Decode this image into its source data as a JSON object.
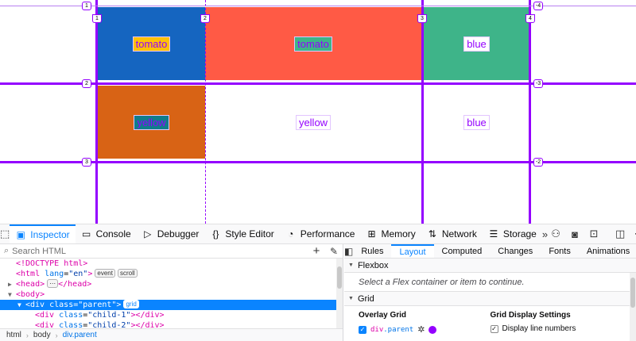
{
  "viewport": {
    "cells": [
      {
        "label": "tomato",
        "color": "#1565c0"
      },
      {
        "label": "tomato",
        "color": "#ffc107"
      },
      {
        "label": "blue",
        "color": "#ff5a45"
      },
      {
        "label": "yellow",
        "color": "#3eb489"
      },
      {
        "label": "yellow",
        "color": "#3eb489"
      },
      {
        "label": "blue",
        "color": "#ffffff"
      },
      {
        "label": "",
        "color": "#d86315"
      },
      {
        "label": "",
        "color": "#117c8c"
      },
      {
        "label": "",
        "color": "#ffffff"
      }
    ],
    "line_numbers": {
      "col_top": [
        "1",
        "2",
        "3",
        "4"
      ],
      "row_left": [
        "1",
        "2",
        "3"
      ],
      "row_right": [
        "-4",
        "-3",
        "-2"
      ],
      "col_corner": "1"
    },
    "overlay_color": "#9400ff"
  },
  "toolbar": {
    "tabs": [
      {
        "label": "Inspector",
        "icon": "inspector-icon"
      },
      {
        "label": "Console",
        "icon": "console-icon"
      },
      {
        "label": "Debugger",
        "icon": "debugger-icon"
      },
      {
        "label": "Style Editor",
        "icon": "style-editor-icon"
      },
      {
        "label": "Performance",
        "icon": "performance-icon"
      },
      {
        "label": "Memory",
        "icon": "memory-icon"
      },
      {
        "label": "Network",
        "icon": "network-icon"
      },
      {
        "label": "Storage",
        "icon": "storage-icon"
      }
    ],
    "accent": "#0a84ff"
  },
  "search": {
    "placeholder": "Search HTML"
  },
  "markup": [
    {
      "indent": 0,
      "text": "<!DOCTYPE html>"
    },
    {
      "indent": 0,
      "open": "<html ",
      "attr": "lang",
      "val": "\"en\"",
      "close": ">",
      "badges": [
        "event",
        "scroll"
      ]
    },
    {
      "indent": 0,
      "twisty": "▶",
      "open": "<head>",
      "badges": [
        "⋯"
      ],
      "after": "</head>"
    },
    {
      "indent": 0,
      "twisty": "▼",
      "open": "<body>"
    },
    {
      "indent": 1,
      "twisty": "▼",
      "open": "<div ",
      "attr": "class",
      "val": "\"parent\"",
      "close": ">",
      "badges": [
        "grid"
      ],
      "selected": true
    },
    {
      "indent": 2,
      "open": "<div ",
      "attr": "class",
      "val": "\"child-1\"",
      "close": "></div>"
    },
    {
      "indent": 2,
      "open": "<div ",
      "attr": "class",
      "val": "\"child-2\"",
      "close": "></div>"
    }
  ],
  "breadcrumbs": [
    "html",
    "body",
    "div.parent"
  ],
  "rule_tabs": [
    "Rules",
    "Layout",
    "Computed",
    "Changes",
    "Fonts",
    "Animations"
  ],
  "active_rule_tab": "Layout",
  "layout": {
    "flexbox_title": "Flexbox",
    "flexbox_message": "Select a Flex container or item to continue.",
    "grid_title": "Grid",
    "overlay_grid_heading": "Overlay Grid",
    "overlay_item": {
      "tag": "div",
      "cls": ".parent",
      "color": "#9400ff"
    },
    "display_settings_heading": "Grid Display Settings",
    "display_line_numbers": "Display line numbers"
  }
}
